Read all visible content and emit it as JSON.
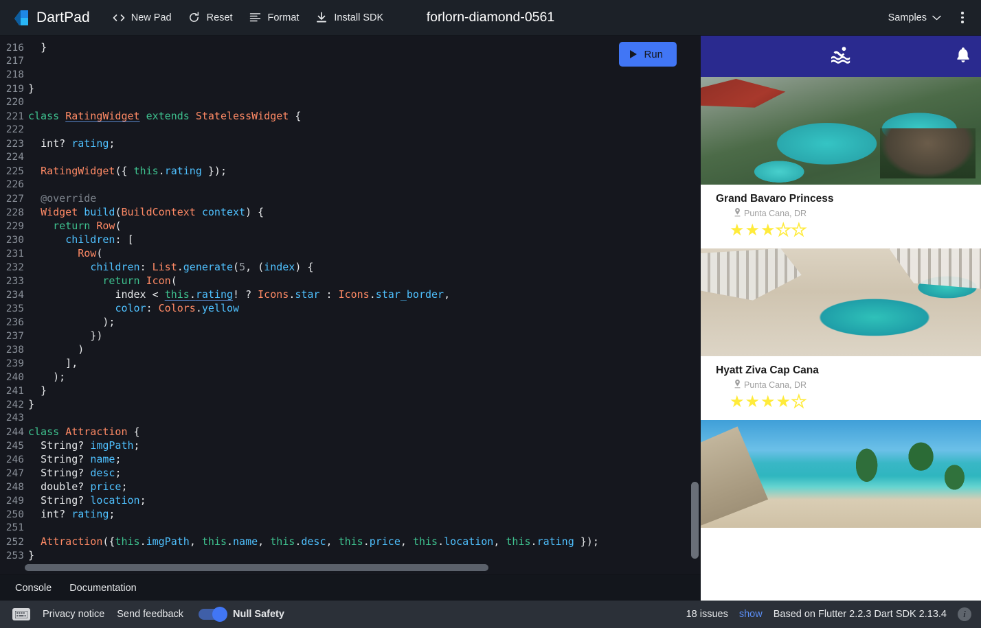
{
  "header": {
    "brand": "DartPad",
    "nav": [
      {
        "label": "New Pad",
        "icon": "code-brackets-icon"
      },
      {
        "label": "Reset",
        "icon": "refresh-icon"
      },
      {
        "label": "Format",
        "icon": "format-lines-icon"
      },
      {
        "label": "Install SDK",
        "icon": "download-icon"
      }
    ],
    "pad_title": "forlorn-diamond-0561",
    "samples_label": "Samples",
    "more_label": "More actions"
  },
  "editor": {
    "run_label": "Run",
    "first_line": 216,
    "lines": [
      {
        "n": 216,
        "tokens": [
          {
            "t": "  ",
            "c": "plain"
          },
          {
            "t": "}",
            "c": "plain"
          }
        ]
      },
      {
        "n": 217,
        "tokens": []
      },
      {
        "n": 218,
        "tokens": []
      },
      {
        "n": 219,
        "tokens": [
          {
            "t": "}",
            "c": "plain"
          }
        ]
      },
      {
        "n": 220,
        "tokens": []
      },
      {
        "n": 221,
        "tokens": [
          {
            "t": "class ",
            "c": "kw"
          },
          {
            "t": "RatingWidget",
            "c": "type und"
          },
          {
            "t": " ",
            "c": "plain"
          },
          {
            "t": "extends ",
            "c": "kw"
          },
          {
            "t": "StatelessWidget",
            "c": "type"
          },
          {
            "t": " {",
            "c": "plain"
          }
        ]
      },
      {
        "n": 222,
        "tokens": []
      },
      {
        "n": 223,
        "tokens": [
          {
            "t": "  ",
            "c": "plain"
          },
          {
            "t": "int?",
            "c": "plain"
          },
          {
            "t": " ",
            "c": "plain"
          },
          {
            "t": "rating",
            "c": "var"
          },
          {
            "t": ";",
            "c": "plain"
          }
        ]
      },
      {
        "n": 224,
        "tokens": []
      },
      {
        "n": 225,
        "tokens": [
          {
            "t": "  ",
            "c": "plain"
          },
          {
            "t": "RatingWidget",
            "c": "type"
          },
          {
            "t": "({ ",
            "c": "plain"
          },
          {
            "t": "this",
            "c": "kw"
          },
          {
            "t": ".",
            "c": "plain"
          },
          {
            "t": "rating",
            "c": "var"
          },
          {
            "t": " });",
            "c": "plain"
          }
        ]
      },
      {
        "n": 226,
        "tokens": []
      },
      {
        "n": 227,
        "tokens": [
          {
            "t": "  ",
            "c": "plain"
          },
          {
            "t": "@override",
            "c": "cmt"
          }
        ]
      },
      {
        "n": 228,
        "tokens": [
          {
            "t": "  ",
            "c": "plain"
          },
          {
            "t": "Widget",
            "c": "type"
          },
          {
            "t": " ",
            "c": "plain"
          },
          {
            "t": "build",
            "c": "var"
          },
          {
            "t": "(",
            "c": "plain"
          },
          {
            "t": "BuildContext",
            "c": "type"
          },
          {
            "t": " ",
            "c": "plain"
          },
          {
            "t": "context",
            "c": "var"
          },
          {
            "t": ") {",
            "c": "plain"
          }
        ]
      },
      {
        "n": 229,
        "tokens": [
          {
            "t": "    ",
            "c": "plain"
          },
          {
            "t": "return ",
            "c": "kw"
          },
          {
            "t": "Row",
            "c": "type"
          },
          {
            "t": "(",
            "c": "plain"
          }
        ]
      },
      {
        "n": 230,
        "tokens": [
          {
            "t": "      ",
            "c": "plain"
          },
          {
            "t": "children",
            "c": "var"
          },
          {
            "t": ": [",
            "c": "plain"
          }
        ]
      },
      {
        "n": 231,
        "tokens": [
          {
            "t": "        ",
            "c": "plain"
          },
          {
            "t": "Row",
            "c": "type"
          },
          {
            "t": "(",
            "c": "plain"
          }
        ]
      },
      {
        "n": 232,
        "tokens": [
          {
            "t": "          ",
            "c": "plain"
          },
          {
            "t": "children",
            "c": "var"
          },
          {
            "t": ": ",
            "c": "plain"
          },
          {
            "t": "List",
            "c": "type"
          },
          {
            "t": ".",
            "c": "plain"
          },
          {
            "t": "generate",
            "c": "var"
          },
          {
            "t": "(",
            "c": "plain"
          },
          {
            "t": "5",
            "c": "num"
          },
          {
            "t": ", (",
            "c": "plain"
          },
          {
            "t": "index",
            "c": "var"
          },
          {
            "t": ") {",
            "c": "plain"
          }
        ]
      },
      {
        "n": 233,
        "tokens": [
          {
            "t": "            ",
            "c": "plain"
          },
          {
            "t": "return ",
            "c": "kw"
          },
          {
            "t": "Icon",
            "c": "type"
          },
          {
            "t": "(",
            "c": "plain"
          }
        ]
      },
      {
        "n": 234,
        "tokens": [
          {
            "t": "              ",
            "c": "plain"
          },
          {
            "t": "index",
            "c": "plain"
          },
          {
            "t": " < ",
            "c": "plain"
          },
          {
            "t": "this",
            "c": "kw und"
          },
          {
            "t": ".",
            "c": "plain und"
          },
          {
            "t": "rating",
            "c": "var und"
          },
          {
            "t": "! ? ",
            "c": "plain"
          },
          {
            "t": "Icons",
            "c": "type"
          },
          {
            "t": ".",
            "c": "plain"
          },
          {
            "t": "star",
            "c": "var"
          },
          {
            "t": " : ",
            "c": "plain"
          },
          {
            "t": "Icons",
            "c": "type"
          },
          {
            "t": ".",
            "c": "plain"
          },
          {
            "t": "star_border",
            "c": "var"
          },
          {
            "t": ",",
            "c": "plain"
          }
        ]
      },
      {
        "n": 235,
        "tokens": [
          {
            "t": "              ",
            "c": "plain"
          },
          {
            "t": "color",
            "c": "var"
          },
          {
            "t": ": ",
            "c": "plain"
          },
          {
            "t": "Colors",
            "c": "type"
          },
          {
            "t": ".",
            "c": "plain"
          },
          {
            "t": "yellow",
            "c": "var"
          }
        ]
      },
      {
        "n": 236,
        "tokens": [
          {
            "t": "            );",
            "c": "plain"
          }
        ]
      },
      {
        "n": 237,
        "tokens": [
          {
            "t": "          })",
            "c": "plain"
          }
        ]
      },
      {
        "n": 238,
        "tokens": [
          {
            "t": "        )",
            "c": "plain"
          }
        ]
      },
      {
        "n": 239,
        "tokens": [
          {
            "t": "      ],",
            "c": "plain"
          }
        ]
      },
      {
        "n": 240,
        "tokens": [
          {
            "t": "    );",
            "c": "plain"
          }
        ]
      },
      {
        "n": 241,
        "tokens": [
          {
            "t": "  }",
            "c": "plain"
          }
        ]
      },
      {
        "n": 242,
        "tokens": [
          {
            "t": "}",
            "c": "plain"
          }
        ]
      },
      {
        "n": 243,
        "tokens": []
      },
      {
        "n": 244,
        "tokens": [
          {
            "t": "class ",
            "c": "kw"
          },
          {
            "t": "Attraction",
            "c": "type"
          },
          {
            "t": " {",
            "c": "plain"
          }
        ]
      },
      {
        "n": 245,
        "tokens": [
          {
            "t": "  ",
            "c": "plain"
          },
          {
            "t": "String?",
            "c": "plain"
          },
          {
            "t": " ",
            "c": "plain"
          },
          {
            "t": "imgPath",
            "c": "var"
          },
          {
            "t": ";",
            "c": "plain"
          }
        ]
      },
      {
        "n": 246,
        "tokens": [
          {
            "t": "  ",
            "c": "plain"
          },
          {
            "t": "String?",
            "c": "plain"
          },
          {
            "t": " ",
            "c": "plain"
          },
          {
            "t": "name",
            "c": "var"
          },
          {
            "t": ";",
            "c": "plain"
          }
        ]
      },
      {
        "n": 247,
        "tokens": [
          {
            "t": "  ",
            "c": "plain"
          },
          {
            "t": "String?",
            "c": "plain"
          },
          {
            "t": " ",
            "c": "plain"
          },
          {
            "t": "desc",
            "c": "var"
          },
          {
            "t": ";",
            "c": "plain"
          }
        ]
      },
      {
        "n": 248,
        "tokens": [
          {
            "t": "  ",
            "c": "plain"
          },
          {
            "t": "double?",
            "c": "plain"
          },
          {
            "t": " ",
            "c": "plain"
          },
          {
            "t": "price",
            "c": "var"
          },
          {
            "t": ";",
            "c": "plain"
          }
        ]
      },
      {
        "n": 249,
        "tokens": [
          {
            "t": "  ",
            "c": "plain"
          },
          {
            "t": "String?",
            "c": "plain"
          },
          {
            "t": " ",
            "c": "plain"
          },
          {
            "t": "location",
            "c": "var"
          },
          {
            "t": ";",
            "c": "plain"
          }
        ]
      },
      {
        "n": 250,
        "tokens": [
          {
            "t": "  ",
            "c": "plain"
          },
          {
            "t": "int?",
            "c": "plain"
          },
          {
            "t": " ",
            "c": "plain"
          },
          {
            "t": "rating",
            "c": "var"
          },
          {
            "t": ";",
            "c": "plain"
          }
        ]
      },
      {
        "n": 251,
        "tokens": []
      },
      {
        "n": 252,
        "tokens": [
          {
            "t": "  ",
            "c": "plain"
          },
          {
            "t": "Attraction",
            "c": "type"
          },
          {
            "t": "({",
            "c": "plain"
          },
          {
            "t": "this",
            "c": "kw"
          },
          {
            "t": ".",
            "c": "plain"
          },
          {
            "t": "imgPath",
            "c": "var"
          },
          {
            "t": ", ",
            "c": "plain"
          },
          {
            "t": "this",
            "c": "kw"
          },
          {
            "t": ".",
            "c": "plain"
          },
          {
            "t": "name",
            "c": "var"
          },
          {
            "t": ", ",
            "c": "plain"
          },
          {
            "t": "this",
            "c": "kw"
          },
          {
            "t": ".",
            "c": "plain"
          },
          {
            "t": "desc",
            "c": "var"
          },
          {
            "t": ", ",
            "c": "plain"
          },
          {
            "t": "this",
            "c": "kw"
          },
          {
            "t": ".",
            "c": "plain"
          },
          {
            "t": "price",
            "c": "var"
          },
          {
            "t": ", ",
            "c": "plain"
          },
          {
            "t": "this",
            "c": "kw"
          },
          {
            "t": ".",
            "c": "plain"
          },
          {
            "t": "location",
            "c": "var"
          },
          {
            "t": ", ",
            "c": "plain"
          },
          {
            "t": "this",
            "c": "kw"
          },
          {
            "t": ".",
            "c": "plain"
          },
          {
            "t": "rating",
            "c": "var"
          },
          {
            "t": " });",
            "c": "plain"
          }
        ]
      },
      {
        "n": 253,
        "tokens": [
          {
            "t": "}",
            "c": "plain"
          }
        ]
      }
    ]
  },
  "console_tabs": [
    {
      "label": "Console"
    },
    {
      "label": "Documentation"
    }
  ],
  "preview": {
    "appbar": {
      "bg": "#2a2a8f",
      "center_icon": "pool-swimmer-icon",
      "action_icon": "bell-icon"
    },
    "cards": [
      {
        "title": "Grand Bavaro Princess",
        "location": "Punta Cana, DR",
        "rating": 3,
        "max_rating": 5,
        "image_alt": "aerial view of resort pool with red-roofed building and palm trees"
      },
      {
        "title": "Hyatt Ziva Cap Cana",
        "location": "Punta Cana, DR",
        "rating": 4,
        "max_rating": 5,
        "image_alt": "aerial view of white resort buildings around a lagoon pool"
      },
      {
        "title": "",
        "location": "",
        "rating": 0,
        "max_rating": 5,
        "image_alt": "beach with thatched roof bar, pier and turquoise sea"
      }
    ],
    "star_color": "#ffeb3b"
  },
  "statusbar": {
    "keyboard_icon": "keyboard-icon",
    "privacy_label": "Privacy notice",
    "feedback_label": "Send feedback",
    "null_safety_label": "Null Safety",
    "null_safety_on": true,
    "issues_text": "18 issues",
    "show_label": "show",
    "version_text": "Based on Flutter 2.2.3 Dart SDK 2.13.4",
    "info_icon": "info-icon"
  },
  "colors": {
    "accent_blue": "#4176f5",
    "header_bg": "#1c2128",
    "editor_bg": "#15171e",
    "statusbar_bg": "#2b3038",
    "appbar_indigo": "#2a2a8f"
  }
}
